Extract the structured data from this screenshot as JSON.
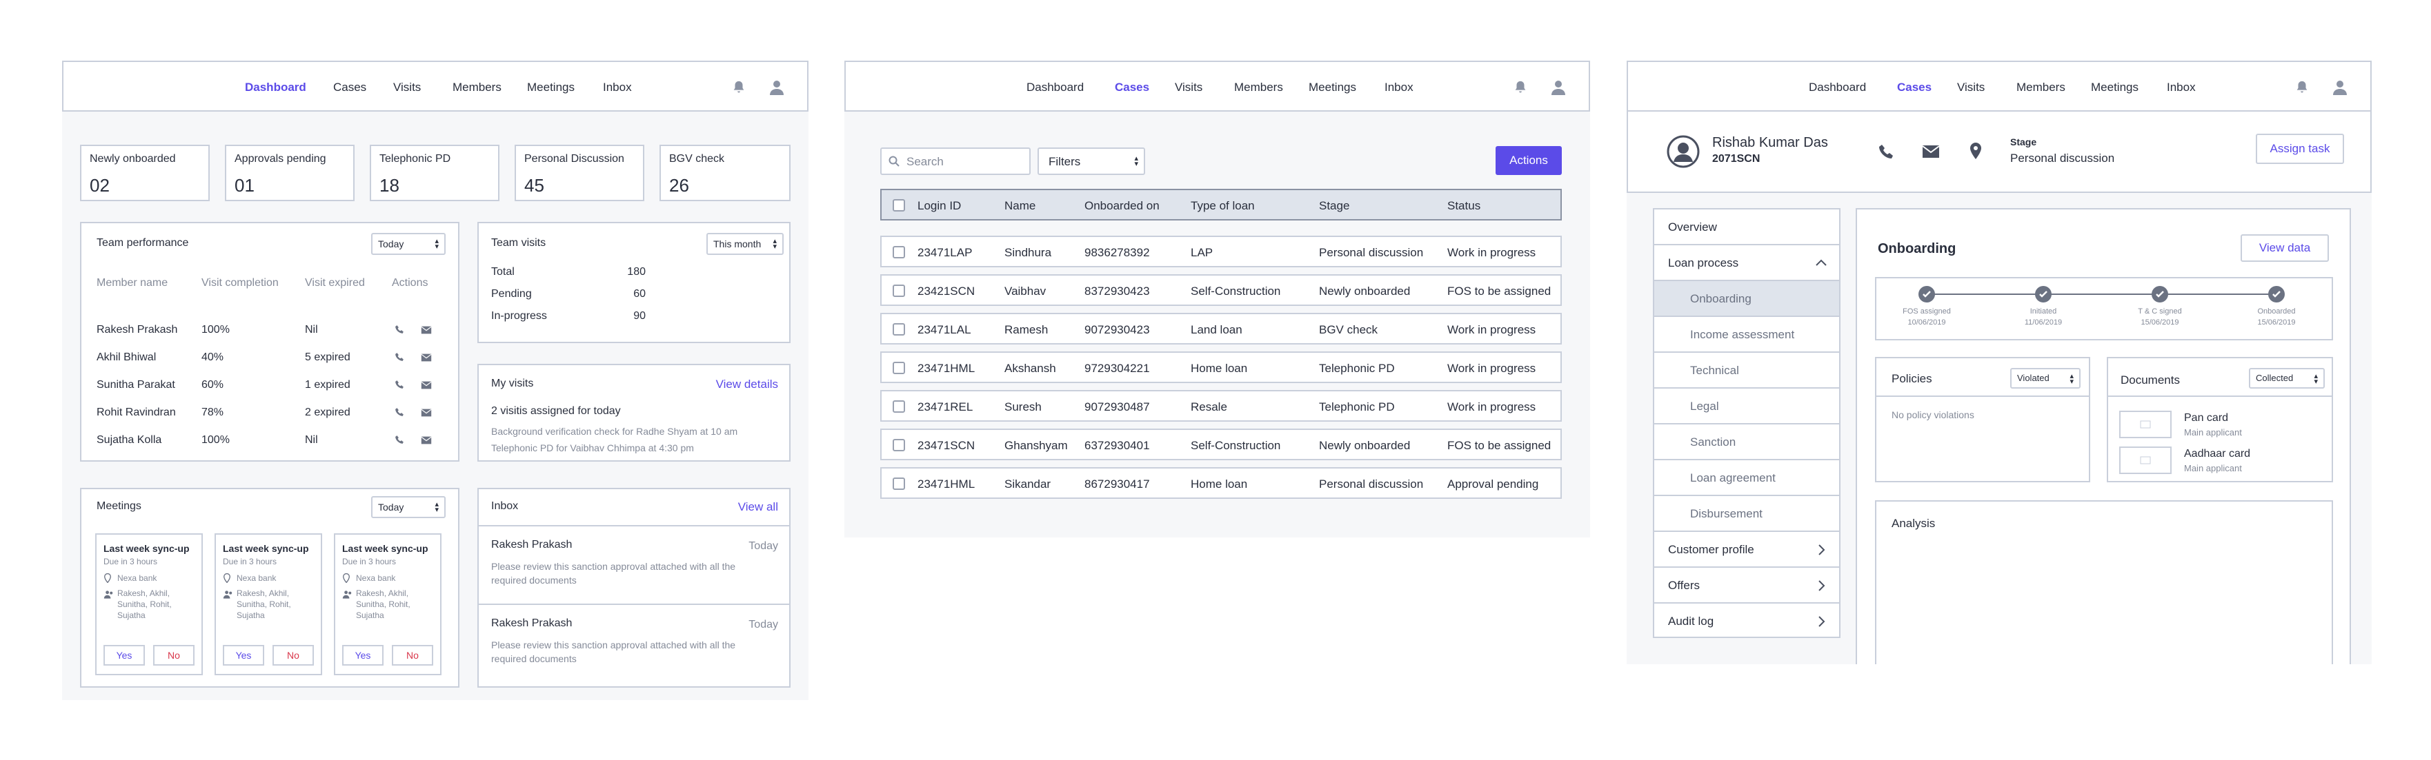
{
  "nav": {
    "dashboard": "Dashboard",
    "cases": "Cases",
    "visits": "Visits",
    "members": "Members",
    "meetings": "Meetings",
    "inbox": "Inbox"
  },
  "dashboard": {
    "stats": [
      {
        "label": "Newly onboarded",
        "value": "02"
      },
      {
        "label": "Approvals pending",
        "value": "01"
      },
      {
        "label": "Telephonic PD",
        "value": "18"
      },
      {
        "label": "Personal Discussion",
        "value": "45"
      },
      {
        "label": "BGV check",
        "value": "26"
      }
    ],
    "team_performance": {
      "title": "Team performance",
      "filter": "Today",
      "columns": [
        "Member name",
        "Visit completion",
        "Visit expired",
        "Actions"
      ],
      "rows": [
        {
          "name": "Rakesh Prakash",
          "completion": "100%",
          "expired": "Nil"
        },
        {
          "name": "Akhil Bhiwal",
          "completion": "40%",
          "expired": "5 expired"
        },
        {
          "name": "Sunitha Parakat",
          "completion": "60%",
          "expired": "1 expired"
        },
        {
          "name": "Rohit Ravindran",
          "completion": "78%",
          "expired": "2 expired"
        },
        {
          "name": "Sujatha Kolla",
          "completion": "100%",
          "expired": "Nil"
        }
      ]
    },
    "team_visits": {
      "title": "Team visits",
      "filter": "This month",
      "rows": [
        {
          "label": "Total",
          "value": "180"
        },
        {
          "label": "Pending",
          "value": "60"
        },
        {
          "label": "In-progress",
          "value": "90"
        }
      ]
    },
    "my_visits": {
      "title": "My visits",
      "link": "View details",
      "headline": "2 visitis assigned for today",
      "lines": [
        "Background verification check for Radhe Shyam at 10 am",
        "Telephonic PD for Vaibhav Chhimpa at 4:30 pm"
      ]
    },
    "meetings": {
      "title": "Meetings",
      "filter": "Today",
      "cards": [
        {
          "title": "Last week sync-up",
          "due": "Due in 3 hours",
          "place": "Nexa bank",
          "people": [
            "Rakesh, Akhil,",
            "Sunitha, Rohit,",
            "Sujatha"
          ],
          "yes": "Yes",
          "no": "No"
        },
        {
          "title": "Last week sync-up",
          "due": "Due in 3 hours",
          "place": "Nexa bank",
          "people": [
            "Rakesh, Akhil,",
            "Sunitha, Rohit,",
            "Sujatha"
          ],
          "yes": "Yes",
          "no": "No"
        },
        {
          "title": "Last week sync-up",
          "due": "Due in 3 hours",
          "place": "Nexa bank",
          "people": [
            "Rakesh, Akhil,",
            "Sunitha, Rohit,",
            "Sujatha"
          ],
          "yes": "Yes",
          "no": "No"
        }
      ]
    },
    "inbox": {
      "title": "Inbox",
      "link": "View all",
      "messages": [
        {
          "from": "Rakesh Prakash",
          "when": "Today",
          "body1": "Please review this sanction approval attached with all the",
          "body2": "required documents"
        },
        {
          "from": "Rakesh Prakash",
          "when": "Today",
          "body1": "Please review this sanction approval attached with all the",
          "body2": "required documents"
        }
      ]
    }
  },
  "cases": {
    "search_placeholder": "Search",
    "filters": "Filters",
    "actions": "Actions",
    "columns": [
      "Login ID",
      "Name",
      "Onboarded on",
      "Type of loan",
      "Stage",
      "Status"
    ],
    "rows": [
      [
        "23471LAP",
        "Sindhura",
        "9836278392",
        "LAP",
        "Personal discussion",
        "Work in progress"
      ],
      [
        "23421SCN",
        "Vaibhav",
        "8372930423",
        "Self-Construction",
        "Newly onboarded",
        "FOS to be assigned"
      ],
      [
        "23471LAL",
        "Ramesh",
        "9072930423",
        "Land loan",
        "BGV check",
        "Work in progress"
      ],
      [
        "23471HML",
        "Akshansh",
        "9729304221",
        "Home loan",
        "Telephonic PD",
        "Work in progress"
      ],
      [
        "23471REL",
        "Suresh",
        "9072930487",
        "Resale",
        "Telephonic PD",
        "Work in progress"
      ],
      [
        "23471SCN",
        "Ghanshyam",
        "6372930401",
        "Self-Construction",
        "Newly onboarded",
        "FOS to be assigned"
      ],
      [
        "23471HML",
        "Sikandar",
        "8672930417",
        "Home loan",
        "Personal discussion",
        "Approval pending"
      ]
    ]
  },
  "case_detail": {
    "name": "Rishab Kumar Das",
    "id": "2071SCN",
    "stage_label": "Stage",
    "stage_value": "Personal discussion",
    "assign": "Assign task",
    "sidebar": {
      "overview": "Overview",
      "loan_process": "Loan process",
      "sub": [
        "Onboarding",
        "Income assessment",
        "Technical",
        "Legal",
        "Sanction",
        "Loan agreement",
        "Disbursement"
      ],
      "customer_profile": "Customer profile",
      "offers": "Offers",
      "audit_log": "Audit log"
    },
    "onboarding": {
      "title": "Onboarding",
      "view": "View data",
      "steps": [
        {
          "label": "FOS assigned",
          "date": "10/06/2019"
        },
        {
          "label": "Initiated",
          "date": "11/06/2019"
        },
        {
          "label": "T & C signed",
          "date": "15/06/2019"
        },
        {
          "label": "Onboarded",
          "date": "15/06/2019"
        }
      ]
    },
    "policies": {
      "title": "Policies",
      "filter": "Violated",
      "note": "No policy violations"
    },
    "documents": {
      "title": "Documents",
      "filter": "Collected",
      "items": [
        {
          "name": "Pan card",
          "sub": "Main applicant"
        },
        {
          "name": "Aadhaar card",
          "sub": "Main applicant"
        }
      ]
    },
    "analysis": "Analysis"
  },
  "icons": {
    "bell": "bell-icon",
    "user": "user-icon",
    "phone": "phone-icon",
    "mail": "mail-icon",
    "pin": "location-pin-icon",
    "check": "check-icon"
  },
  "colors": {
    "accent": "#5b4be8",
    "border": "#c9cfdb",
    "danger": "#d9364a",
    "step": "#6b7282"
  }
}
